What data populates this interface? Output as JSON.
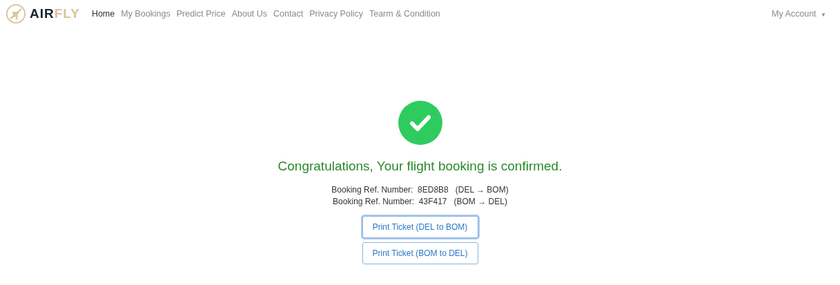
{
  "logo": {
    "dark": "AIR",
    "light": "FLY"
  },
  "nav": [
    {
      "label": "Home",
      "selected": true
    },
    {
      "label": "My Bookings",
      "selected": false
    },
    {
      "label": "Predict Price",
      "selected": false
    },
    {
      "label": "About Us",
      "selected": false
    },
    {
      "label": "Contact",
      "selected": false
    },
    {
      "label": "Privacy Policy",
      "selected": false
    },
    {
      "label": "Tearm & Condition",
      "selected": false
    }
  ],
  "account": {
    "label": "My Account",
    "caret": "▼"
  },
  "message": "Congratulations, Your flight booking is confirmed.",
  "bookings": [
    {
      "label": "Booking Ref. Number:",
      "ref": "8ED8B8",
      "route": "(DEL → BOM)"
    },
    {
      "label": "Booking Ref. Number:",
      "ref": "43F417",
      "route": "(BOM → DEL)"
    }
  ],
  "buttons": [
    {
      "label": "Print Ticket (DEL to BOM)",
      "focused": true
    },
    {
      "label": "Print Ticket (BOM to DEL)",
      "focused": false
    }
  ]
}
